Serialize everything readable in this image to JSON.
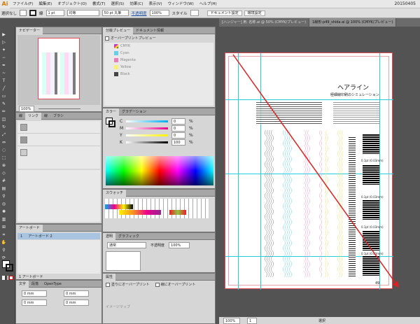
{
  "app": {
    "logo": "Ai"
  },
  "menubar": {
    "items": [
      "ファイル(F)",
      "編集(E)",
      "オブジェクト(O)",
      "書式(T)",
      "選択(S)",
      "効果(C)",
      "表示(V)",
      "ウィンドウ(W)",
      "ヘルプ(H)"
    ],
    "right_label": "20150405",
    "doc_setup": "ドキュメント設定",
    "prefs": "環境設定"
  },
  "control_bar": {
    "selection": "選択なし",
    "stroke_label": "線",
    "stroke_weight": "1 pt",
    "stroke_profile": "均等",
    "brush": "50 pt 丸筆",
    "opacity_label": "不透明度",
    "opacity": "100%",
    "style_label": "スタイル"
  },
  "doc_tabs": [
    {
      "label": "[ハンジャー] 用. 名称.ai @ 50% (CMYK/プレビュー)",
      "active": false
    },
    {
      "label": "1線形-p49_shida.ai @ 100% (CMYK/プレビュー)",
      "active": true
    }
  ],
  "navigator": {
    "tab": "ナビゲーター",
    "zoom": "100%"
  },
  "separations": {
    "tabs": [
      "分版プレビュー",
      "ドキュメント情報"
    ],
    "overprint": "オーバープリントプレビュー",
    "inks": [
      "CMYK",
      "Cyan",
      "Magenta",
      "Yellow",
      "Black"
    ]
  },
  "color_panel": {
    "tabs": [
      "カラー",
      "グラデーション"
    ],
    "channels": [
      {
        "label": "C",
        "value": "0",
        "unit": "%"
      },
      {
        "label": "M",
        "value": "0",
        "unit": "%"
      },
      {
        "label": "Y",
        "value": "0",
        "unit": "%"
      },
      {
        "label": "K",
        "value": "100",
        "unit": "%"
      }
    ]
  },
  "swatches": {
    "tab": "スウォッチ"
  },
  "links_panel": {
    "tabs": [
      "線",
      "リンク",
      "線",
      "ブラシ"
    ]
  },
  "artboards": {
    "tab": "アートボード",
    "items": [
      {
        "num": "1",
        "name": "アートボード 2"
      }
    ],
    "footer": "1 アートボード"
  },
  "transparency": {
    "tabs": [
      "透明",
      "グラフィック"
    ],
    "mode": "通常",
    "opacity_label": "不透明度",
    "opacity": "100%"
  },
  "attributes": {
    "tab": "属性",
    "fill_overprint": "塗りにオーバープリント",
    "stroke_overprint": "線にオーバープリント",
    "image_label": "イメージマップ"
  },
  "char_panel": {
    "tabs": [
      "文字",
      "段落",
      "OpenType",
      "整列"
    ],
    "fields": [
      "0 mm",
      "0 mm",
      "0 mm",
      "0 mm"
    ]
  },
  "document": {
    "title": "ヘアライン",
    "subtitle": "極細線印刷のシミュレーション",
    "labels": [
      "0.1pt (0.03mm)",
      "0.1pt (0.03mm)",
      "0.1pt (0.03mm)",
      "0.1pt (0.03mm)"
    ],
    "page_number": "49"
  },
  "status": {
    "zoom": "100%",
    "page": "1",
    "tool": "選択"
  }
}
